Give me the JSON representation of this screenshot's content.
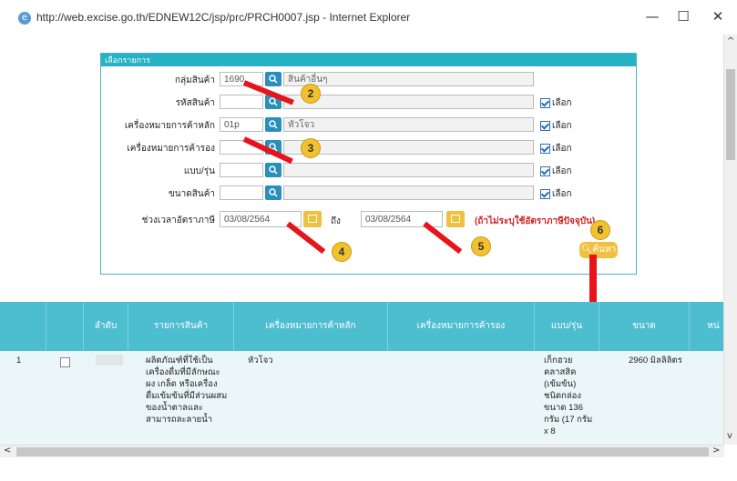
{
  "window": {
    "title": "http://web.excise.go.th/EDNEW12C/jsp/prc/PRCH0007.jsp - Internet Explorer",
    "minimize": "—",
    "maximize": "☐",
    "close": "✕"
  },
  "panel": {
    "header": "เลือกรายการ",
    "fields": [
      {
        "label": "กลุ่มสินค้า",
        "code": "1690",
        "name": "สินค้าอื่นๆ",
        "check": ""
      },
      {
        "label": "รหัสสินค้า",
        "code": "",
        "name": "",
        "check": "เลือก"
      },
      {
        "label": "เครื่องหมายการค้าหลัก",
        "code": "01p",
        "name": "หัวโจว",
        "check": "เลือก"
      },
      {
        "label": "เครื่องหมายการค้ารอง",
        "code": "",
        "name": "",
        "check": "เลือก"
      },
      {
        "label": "แบบ/รุ่น",
        "code": "",
        "name": "",
        "check": "เลือก"
      },
      {
        "label": "ขนาดสินค้า",
        "code": "",
        "name": "",
        "check": "เลือก"
      }
    ],
    "date_label": "ช่วงเวลาอัตราภาษี",
    "date_from": "03/08/2564",
    "to_label": "ถึง",
    "date_to": "03/08/2564",
    "note": "(ถ้าไม่ระบุใช้อัตราภาษีปัจจุบัน)",
    "find_label": "ค้นหา"
  },
  "badges": [
    "2",
    "3",
    "4",
    "5",
    "6"
  ],
  "table": {
    "headers": [
      "",
      "",
      "ลำดับ",
      "รายการสินค้า",
      "เครื่องหมายการค้าหลัก",
      "เครื่องหมายการค้ารอง",
      "แบบ/รุ่น",
      "ขนาด",
      "หน่"
    ],
    "row": {
      "index": "1",
      "item": "ผลิตภัณฑ์ที่ใช้เป็นเครื่องดื่มที่มีลักษณะผง เกล็ด หรือเครื่องดื่มเข้มข้นที่มีส่วนผสมของน้ำตาลและสามารถละลายน้ำ",
      "brand": "หัวโจว",
      "sub_brand": "",
      "model": "เก็กฮวยคลาสสิค (เข้มข้น) ชนิดกล่อง ขนาด 136 กรัม (17 กรัม x 8",
      "size": "2960 มิลลิลิตร"
    }
  },
  "colors": {
    "accent": "#27b2c4",
    "header": "#4dbdd0",
    "search": "#2a8fbd",
    "button": "#f0c040",
    "arrow": "#e8131b"
  }
}
